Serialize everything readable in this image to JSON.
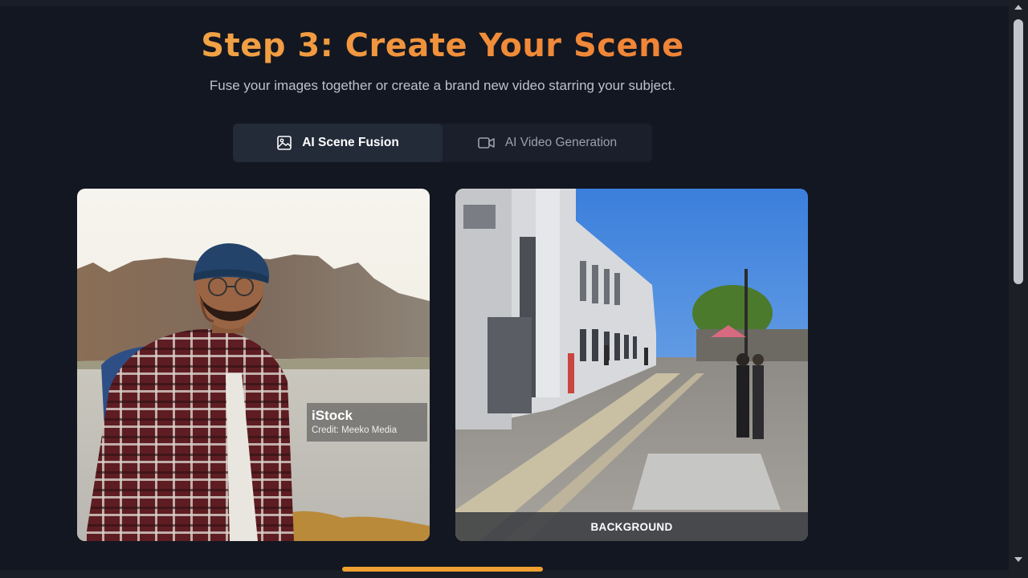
{
  "header": {
    "title": "Step 3: Create Your Scene",
    "subtitle": "Fuse your images together or create a brand new video starring your subject."
  },
  "tabs": [
    {
      "label": "AI Scene Fusion",
      "icon": "image-icon",
      "active": true
    },
    {
      "label": "AI Video Generation",
      "icon": "video-camera-icon",
      "active": false
    }
  ],
  "cards": {
    "subject": {
      "watermark_brand": "iStock",
      "watermark_credit": "Credit: Meeko Media"
    },
    "background": {
      "caption": "BACKGROUND"
    }
  },
  "colors": {
    "page_bg": "#131721",
    "title_gradient_start": "#f2b24e",
    "title_gradient_end": "#ee7a35",
    "active_tab_bg": "#232a38",
    "accent": "#f0a030"
  }
}
